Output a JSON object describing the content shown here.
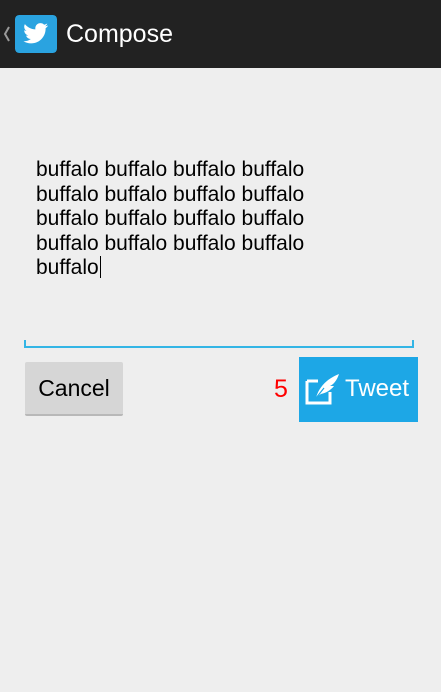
{
  "action_bar": {
    "title": "Compose",
    "up_icon": "chevron-left-icon",
    "app_icon": "twitter-bird-icon",
    "background": "#222222"
  },
  "compose": {
    "text": "buffalo buffalo buffalo buffalo\nbuffalo buffalo buffalo buffalo\nbuffalo buffalo buffalo buffalo\nbuffalo buffalo buffalo buffalo\nbuffalo",
    "underline_color": "#33b5e5"
  },
  "actions": {
    "cancel_label": "Cancel",
    "remaining_chars": "5",
    "remaining_color": "#ff0000",
    "tweet_label": "Tweet",
    "tweet_icon": "compose-quill-icon",
    "tweet_color": "#1da7e6"
  }
}
